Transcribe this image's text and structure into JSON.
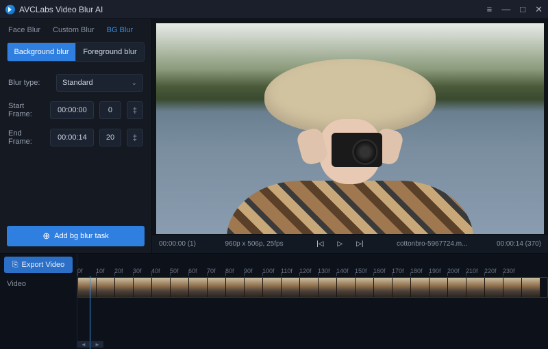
{
  "title": "AVCLabs Video Blur AI",
  "tabs": [
    "Face Blur",
    "Custom Blur",
    "BG Blur"
  ],
  "active_tab": 2,
  "subtabs": {
    "bg": "Background blur",
    "fg": "Foreground blur",
    "active": "bg"
  },
  "fields": {
    "blur_type_label": "Blur type:",
    "blur_type_value": "Standard",
    "start_label": "Start Frame:",
    "start_time": "00:00:00",
    "start_frame": "0",
    "end_label": "End Frame:",
    "end_time": "00:00:14",
    "end_frame": "20"
  },
  "add_task_label": "Add bg blur task",
  "playbar": {
    "pos": "00:00:00 (1)",
    "dims": "960p x 506p, 25fps",
    "filename": "cottonbro-5967724.m...",
    "dur": "00:00:14 (370)"
  },
  "export_label": "Export Video",
  "track_label": "Video",
  "ruler_ticks": [
    "0f",
    "10f",
    "20f",
    "30f",
    "40f",
    "50f",
    "60f",
    "70f",
    "80f",
    "90f",
    "100f",
    "110f",
    "120f",
    "130f",
    "140f",
    "150f",
    "160f",
    "170f",
    "180f",
    "190f",
    "200f",
    "210f",
    "220f",
    "230f"
  ]
}
